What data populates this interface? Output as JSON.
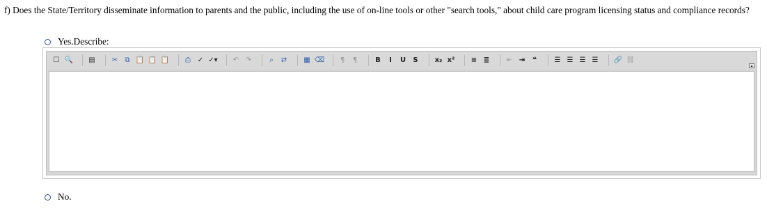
{
  "question": {
    "text": "f) Does the State/Territory disseminate information to parents and the public, including the use of on-line tools or other \"search tools,\" about child care program licensing status and compliance records?"
  },
  "options": {
    "yes_label": "Yes.Describe:",
    "no_label": "No."
  },
  "editor": {
    "toolbar_groups": [
      [
        {
          "name": "new-page-icon",
          "glyph": "☐",
          "style": ""
        },
        {
          "name": "preview-icon",
          "glyph": "🔍",
          "style": ""
        }
      ],
      [
        {
          "name": "templates-icon",
          "glyph": "▤",
          "style": ""
        }
      ],
      [
        {
          "name": "cut-icon",
          "glyph": "✂",
          "style": "blue"
        },
        {
          "name": "copy-icon",
          "glyph": "⧉",
          "style": "blue"
        },
        {
          "name": "paste-icon",
          "glyph": "📋",
          "style": ""
        },
        {
          "name": "paste-text-icon",
          "glyph": "📋",
          "style": ""
        },
        {
          "name": "paste-word-icon",
          "glyph": "📋",
          "style": ""
        }
      ],
      [
        {
          "name": "print-icon",
          "glyph": "⎙",
          "style": "blue"
        },
        {
          "name": "spellcheck-icon",
          "glyph": "✓",
          "style": "dark"
        },
        {
          "name": "spellcheck-dropdown-icon",
          "glyph": "✓▾",
          "style": "dark"
        }
      ],
      [
        {
          "name": "undo-icon",
          "glyph": "↶",
          "style": "gray"
        },
        {
          "name": "redo-icon",
          "glyph": "↷",
          "style": "gray"
        }
      ],
      [
        {
          "name": "find-icon",
          "glyph": "⌕",
          "style": "blue"
        },
        {
          "name": "replace-icon",
          "glyph": "⇄",
          "style": "blue"
        }
      ],
      [
        {
          "name": "select-all-icon",
          "glyph": "▦",
          "style": "blue"
        },
        {
          "name": "remove-format-icon",
          "glyph": "⌫",
          "style": "blue"
        }
      ],
      [
        {
          "name": "ltr-icon",
          "glyph": "¶",
          "style": "gray"
        },
        {
          "name": "rtl-icon",
          "glyph": "¶",
          "style": "gray"
        }
      ],
      [
        {
          "name": "bold-icon",
          "glyph": "B",
          "style": "dark"
        },
        {
          "name": "italic-icon",
          "glyph": "I",
          "style": "dark"
        },
        {
          "name": "underline-icon",
          "glyph": "U",
          "style": "dark"
        },
        {
          "name": "strikethrough-icon",
          "glyph": "S",
          "style": "dark"
        }
      ],
      [
        {
          "name": "subscript-icon",
          "glyph": "x₂",
          "style": "dark"
        },
        {
          "name": "superscript-icon",
          "glyph": "x²",
          "style": "dark"
        }
      ],
      [
        {
          "name": "numbered-list-icon",
          "glyph": "≡",
          "style": "dark"
        },
        {
          "name": "bulleted-list-icon",
          "glyph": "≣",
          "style": "dark"
        }
      ],
      [
        {
          "name": "outdent-icon",
          "glyph": "⇤",
          "style": "gray"
        },
        {
          "name": "indent-icon",
          "glyph": "⇥",
          "style": "dark"
        },
        {
          "name": "blockquote-icon",
          "glyph": "❝",
          "style": "dark"
        }
      ],
      [
        {
          "name": "align-left-icon",
          "glyph": "☰",
          "style": "dark"
        },
        {
          "name": "align-center-icon",
          "glyph": "☰",
          "style": "dark"
        },
        {
          "name": "align-right-icon",
          "glyph": "☰",
          "style": "dark"
        },
        {
          "name": "justify-icon",
          "glyph": "☰",
          "style": "dark"
        }
      ],
      [
        {
          "name": "link-icon",
          "glyph": "🔗",
          "style": "blue"
        },
        {
          "name": "unlink-icon",
          "glyph": "⛓",
          "style": "gray"
        }
      ]
    ],
    "content": ""
  }
}
